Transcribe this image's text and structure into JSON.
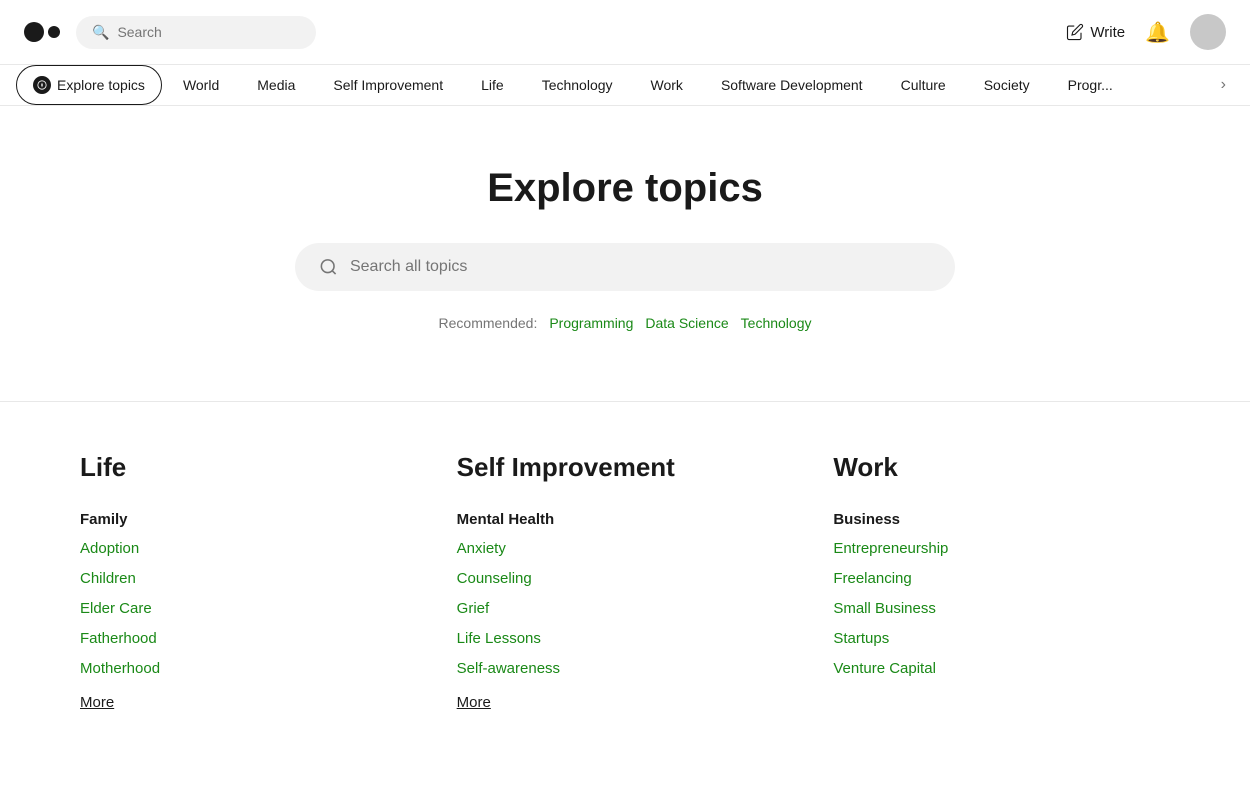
{
  "header": {
    "search_placeholder": "Search",
    "write_label": "Write"
  },
  "nav": {
    "active": "Explore topics",
    "topics": [
      "World",
      "Media",
      "Self Improvement",
      "Life",
      "Technology",
      "Work",
      "Software Development",
      "Culture",
      "Society",
      "Programming"
    ]
  },
  "hero": {
    "title": "Explore topics",
    "search_placeholder": "Search all topics",
    "recommended_label": "Recommended:",
    "recommended_topics": [
      "Programming",
      "Data Science",
      "Technology"
    ]
  },
  "sections": [
    {
      "title": "Life",
      "groups": [
        {
          "name": "Family",
          "items": [
            "Adoption",
            "Children",
            "Elder Care",
            "Fatherhood",
            "Motherhood"
          ],
          "more": "More"
        }
      ]
    },
    {
      "title": "Self Improvement",
      "groups": [
        {
          "name": "Mental Health",
          "items": [
            "Anxiety",
            "Counseling",
            "Grief",
            "Life Lessons",
            "Self-awareness"
          ],
          "more": "More"
        }
      ]
    },
    {
      "title": "Work",
      "groups": [
        {
          "name": "Business",
          "items": [
            "Entrepreneurship",
            "Freelancing",
            "Small Business",
            "Startups",
            "Venture Capital"
          ],
          "more": null
        }
      ]
    }
  ]
}
